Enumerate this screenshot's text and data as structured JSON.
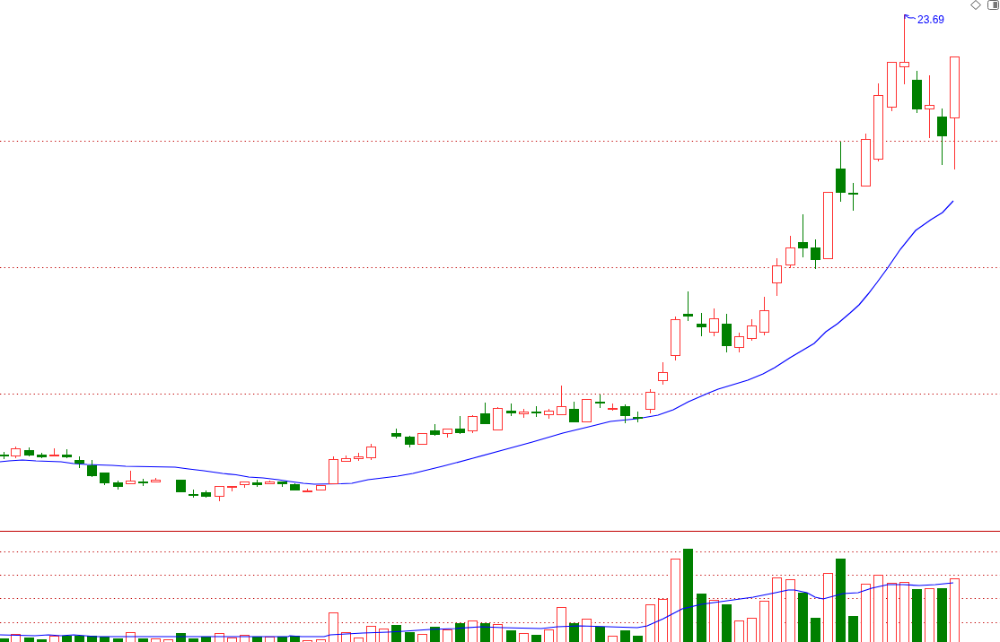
{
  "price_chart": {
    "high_price_label": "23.69"
  }
}
